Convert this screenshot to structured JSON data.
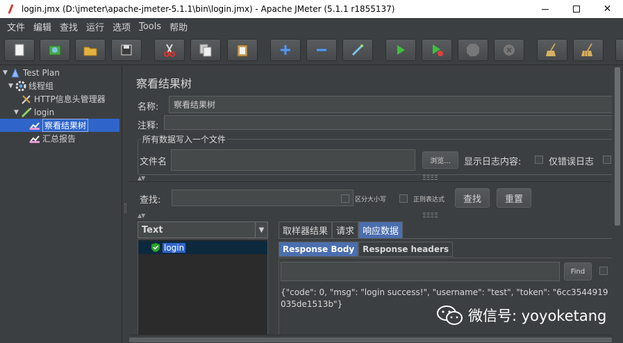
{
  "window": {
    "title": "login.jmx (D:\\jmeter\\apache-jmeter-5.1.1\\bin\\login.jmx) - Apache JMeter (5.1.1 r1855137)",
    "minimize": "",
    "maximize": "",
    "close": "✕"
  },
  "menu": [
    "文件",
    "编辑",
    "查找",
    "运行",
    "选项",
    "Tools",
    "帮助"
  ],
  "toolbar": {
    "buttons": [
      "new-icon",
      "templates-icon",
      "open-icon",
      "save-icon",
      "cut-icon",
      "copy-icon",
      "paste-icon",
      "expand-icon",
      "collapse-icon",
      "toggle-icon",
      "start-icon",
      "start-no-pause-icon",
      "stop-icon",
      "shutdown-icon",
      "clear-icon",
      "clear-all-icon"
    ]
  },
  "tree": {
    "test_plan": "Test Plan",
    "thread_group": "线程组",
    "header_manager": "HTTP信息头管理器",
    "login": "login",
    "result_tree": "察看结果树",
    "summary_report": "汇总报告"
  },
  "panel": {
    "title": "察看结果树",
    "name_label": "名称:",
    "name_value": "察看结果树",
    "comment_label": "注释:",
    "comment_value": "",
    "write_all_legend": "所有数据写入一个文件",
    "filename_label": "文件名",
    "filename_value": "",
    "browse_button": "浏览...",
    "log_content_label": "显示日志内容:",
    "errors_only_label": "仅错误日志",
    "search_label": "查找:",
    "search_value": "",
    "case_sensitive_label": "区分大小写",
    "regex_label": "正则表达式",
    "search_button": "查找",
    "reset_button": "重置"
  },
  "results": {
    "renderer": "Text",
    "items": [
      "login"
    ],
    "tabs": [
      "取样器结果",
      "请求",
      "响应数据"
    ],
    "active_tab": 2,
    "sub_tabs": [
      "Response Body",
      "Response headers"
    ],
    "active_sub_tab": 0,
    "find_value": "",
    "find_button": "Find",
    "response_body": "{\"code\": 0, \"msg\": \"login success!\", \"username\": \"test\", \"token\": \"6cc3544919035de1513b\"}"
  },
  "watermark": "微信号: yoyoketang",
  "colors": {
    "background": "#3c3f41",
    "selection": "#2f65ca",
    "active_tab": "#4b6eaf"
  }
}
